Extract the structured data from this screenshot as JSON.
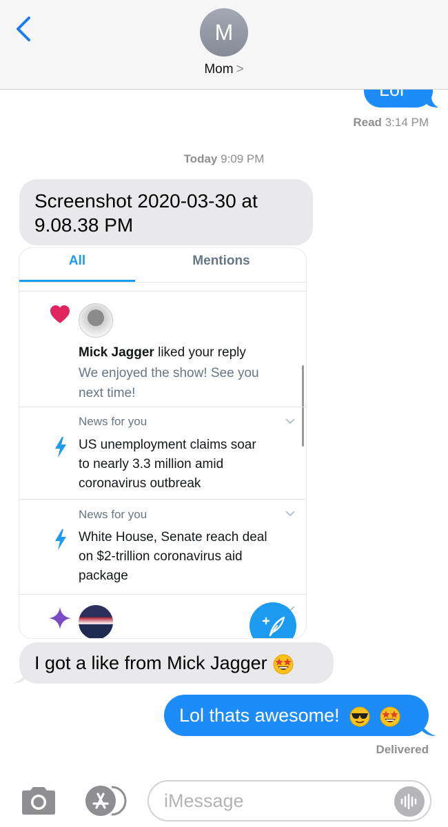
{
  "header": {
    "avatar_initial": "M",
    "contact_name": "Mom",
    "contact_chevron": ">"
  },
  "thread": {
    "peek_text": "Lol",
    "read_label": "Read",
    "read_time": "3:14 PM",
    "divider_day": "Today",
    "divider_time": "9:09 PM",
    "attachment_name_line1": "Screenshot 2020-03-30 at",
    "attachment_name_line2": "9.08.38 PM",
    "received_message": "I got a like from Mick Jagger",
    "sent_message": "Lol thats awesome!",
    "delivered_label": "Delivered"
  },
  "screenshot": {
    "tabs": [
      "All",
      "Mentions"
    ],
    "like": {
      "user": "Mick Jagger",
      "action": "liked your reply",
      "reply_line1": "We enjoyed the show! See you",
      "reply_line2": "next time!"
    },
    "news": [
      {
        "label": "News for you",
        "lines": [
          "US unemployment claims soar",
          "to nearly 3.3 million amid",
          "coronavirus outbreak"
        ]
      },
      {
        "label": "News for you",
        "lines": [
          "White House, Senate reach deal",
          "on $2-trillion coronavirus aid",
          "package"
        ]
      }
    ]
  },
  "input": {
    "placeholder": "iMessage"
  },
  "colors": {
    "imessage_blue": "#1d8cf8",
    "bubble_gray": "#e9e9eb",
    "twitter_blue": "#1d9bf0",
    "heart_red": "#e0245e",
    "sparkle_purple": "#794bc4"
  },
  "icons": [
    "back-chevron-icon",
    "heart-icon",
    "lightning-icon",
    "sparkle-icon",
    "chevron-down-icon",
    "compose-tweet-icon",
    "camera-icon",
    "app-store-icon",
    "audio-waveform-icon",
    "star-struck-emoji",
    "sunglasses-emoji"
  ]
}
